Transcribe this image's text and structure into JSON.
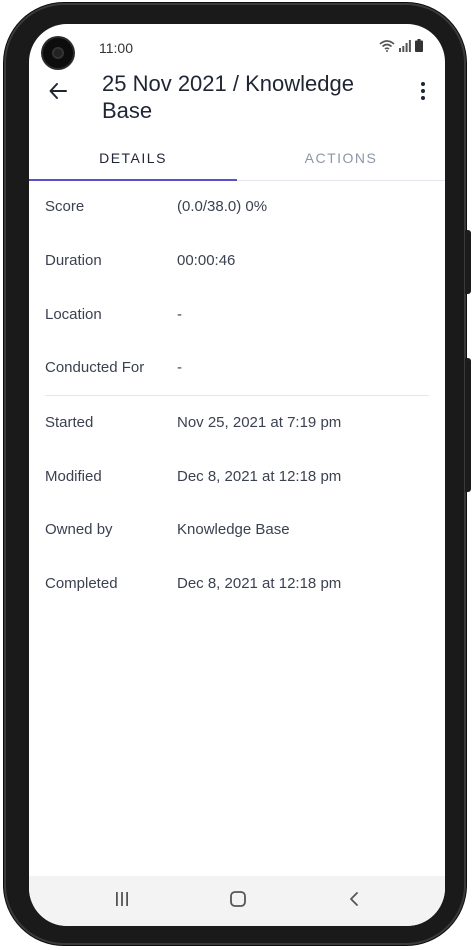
{
  "status_bar": {
    "time": "11:00",
    "icons": [
      "wifi-icon",
      "signal-icon",
      "battery-icon"
    ]
  },
  "app_bar": {
    "title": "25 Nov 2021 / Knowledge Base",
    "back_icon": "arrow-left-icon",
    "menu_icon": "more-vertical-icon"
  },
  "tabs": [
    {
      "label": "DETAILS",
      "selected": true
    },
    {
      "label": "ACTIONS",
      "selected": false
    }
  ],
  "details": {
    "group1": [
      {
        "label": "Score",
        "value": "(0.0/38.0) 0%"
      },
      {
        "label": "Duration",
        "value": "00:00:46"
      },
      {
        "label": "Location",
        "value": "-"
      },
      {
        "label": "Conducted For",
        "value": "-"
      }
    ],
    "group2": [
      {
        "label": "Started",
        "value": "Nov 25, 2021 at 7:19 pm"
      },
      {
        "label": "Modified",
        "value": "Dec 8, 2021 at 12:18 pm"
      },
      {
        "label": "Owned by",
        "value": "Knowledge Base"
      },
      {
        "label": "Completed",
        "value": "Dec 8, 2021 at 12:18 pm"
      }
    ]
  },
  "nav_bar": {
    "icons": [
      "recent-apps-icon",
      "home-icon",
      "back-icon"
    ]
  },
  "colors": {
    "accent": "#5a4fcf",
    "text_primary": "#1f2533",
    "text_secondary": "#3b4150",
    "tab_inactive": "#8e96a6"
  }
}
